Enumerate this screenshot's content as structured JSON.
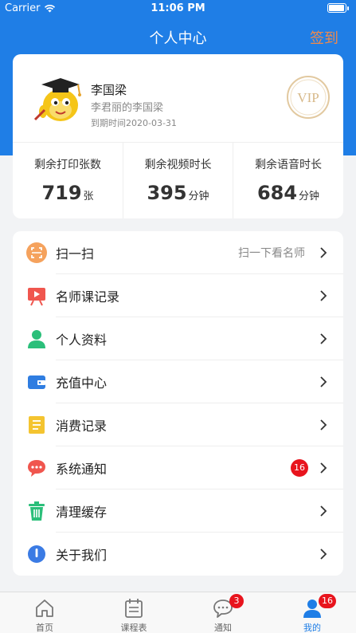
{
  "status_bar": {
    "carrier": "Carrier",
    "time": "11:06 PM"
  },
  "nav": {
    "title": "个人中心",
    "action": "签到"
  },
  "profile": {
    "name": "李国梁",
    "subtitle": "李君丽的李国梁",
    "expire": "到期时间2020-03-31",
    "vip_label": "VIP"
  },
  "stats": [
    {
      "label": "剩余打印张数",
      "value": "719",
      "unit": "张"
    },
    {
      "label": "剩余视频时长",
      "value": "395",
      "unit": "分钟"
    },
    {
      "label": "剩余语音时长",
      "value": "684",
      "unit": "分钟"
    }
  ],
  "menu": [
    {
      "label": "扫一扫",
      "hint": "扫一下看名师",
      "icon": "scan-icon"
    },
    {
      "label": "名师课记录",
      "icon": "video-record-icon"
    },
    {
      "label": "个人资料",
      "icon": "person-icon"
    },
    {
      "label": "充值中心",
      "icon": "wallet-icon"
    },
    {
      "label": "消费记录",
      "icon": "receipt-icon"
    },
    {
      "label": "系统通知",
      "badge": "16",
      "icon": "chat-bubble-icon"
    },
    {
      "label": "清理缓存",
      "icon": "trash-icon"
    },
    {
      "label": "关于我们",
      "icon": "info-icon"
    }
  ],
  "tabs": [
    {
      "label": "首页",
      "icon": "home-icon"
    },
    {
      "label": "课程表",
      "icon": "calendar-icon"
    },
    {
      "label": "通知",
      "badge": "3",
      "icon": "message-icon"
    },
    {
      "label": "我的",
      "badge": "16",
      "icon": "user-icon",
      "active": true
    }
  ],
  "colors": {
    "primary": "#1f7ee6",
    "signin": "#f28a4a",
    "badge": "#e8141d"
  }
}
